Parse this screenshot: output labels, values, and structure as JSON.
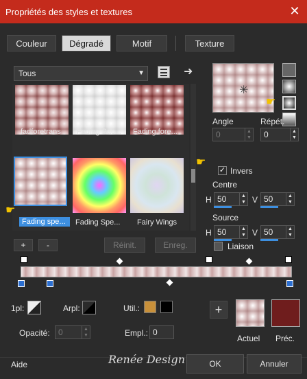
{
  "window": {
    "title": "Propriétés des styles et textures",
    "close_glyph": "✕"
  },
  "tabs": [
    {
      "label": "Couleur",
      "active": false
    },
    {
      "label": "Dégradé",
      "active": true
    },
    {
      "label": "Motif",
      "active": false
    },
    {
      "label": "Texture",
      "active": false
    }
  ],
  "category_dropdown": {
    "value": "Tous"
  },
  "gradients": [
    {
      "label": "fadforetrans"
    },
    {
      "label": "Fading Bac..."
    },
    {
      "label": "Fading fore..."
    },
    {
      "label": "Fading spe...",
      "selected": true
    },
    {
      "label": "Fading Spe..."
    },
    {
      "label": "Fairy Wings"
    }
  ],
  "list_buttons": {
    "add": "+",
    "remove": "-",
    "reset": "Réinit.",
    "save": "Enreg."
  },
  "angle": {
    "label": "Angle",
    "value": "0"
  },
  "repeat": {
    "label": "Répét.",
    "value": "0"
  },
  "invert": {
    "label": "Invers",
    "checked": true
  },
  "center": {
    "label": "Centre",
    "h_label": "H",
    "h_value": "50",
    "v_label": "V",
    "v_value": "50"
  },
  "source": {
    "label": "Source",
    "h_label": "H",
    "h_value": "50",
    "v_label": "V",
    "v_value": "50"
  },
  "link": {
    "label": "Liaison",
    "checked": false
  },
  "stop_controls": {
    "pl_label": "1pl:",
    "arpl_label": "Arpl:",
    "util_label": "Util.:",
    "opacity_label": "Opacité:",
    "opacity_value": "0",
    "empl_label": "Empl.:",
    "empl_value": "0",
    "util_color": "#c8903a",
    "util_color2": "#000000"
  },
  "preview": {
    "current_label": "Actuel",
    "previous_label": "Préc.",
    "previous_color": "#6f1d1d",
    "add_glyph": "+"
  },
  "footer": {
    "help": "Aide",
    "ok": "OK",
    "cancel": "Annuler",
    "watermark": "Renée Design"
  },
  "colors": {
    "titlebar": "#c42b1c",
    "accent": "#3d8fe0"
  },
  "icons": [
    "close-icon",
    "palette-icon",
    "arrow-right-icon",
    "gradient-style-icons",
    "hand-pointer-icon",
    "chevron-down-icon"
  ]
}
